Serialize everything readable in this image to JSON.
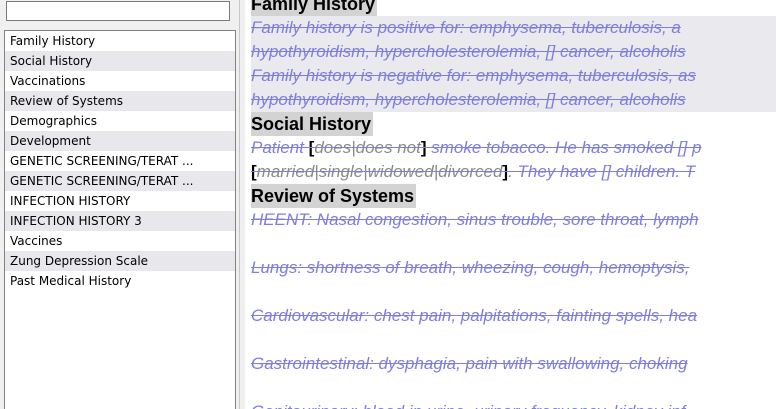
{
  "search": {
    "value": "",
    "placeholder": ""
  },
  "sidebar": {
    "items": [
      {
        "label": "Family History"
      },
      {
        "label": "Social History"
      },
      {
        "label": "Vaccinations"
      },
      {
        "label": "Review of Systems"
      },
      {
        "label": "Demographics"
      },
      {
        "label": "Development"
      },
      {
        "label": "GENETIC SCREENING/TERAT ..."
      },
      {
        "label": "GENETIC SCREENING/TERAT ..."
      },
      {
        "label": "INFECTION HISTORY"
      },
      {
        "label": "INFECTION HISTORY 3"
      },
      {
        "label": "Vaccines"
      },
      {
        "label": "Zung Depression Scale"
      },
      {
        "label": "Past Medical History"
      }
    ]
  },
  "document": {
    "family_history": {
      "heading": "Family History",
      "line1": "Family history is positive for: emphysema, tuberculosis, a",
      "line2": "hypothyroidism, hypercholesterolemia, [] cancer, alcoholis",
      "line3": "Family history is negative for: emphysema, tuberculosis, as",
      "line4": "hypothyroidism, hypercholesterolemia, [] cancer, alcoholis"
    },
    "social_history": {
      "heading": "Social History",
      "l1_prefix": "Patient ",
      "bracket_open": "[",
      "bracket_close": "]",
      "l1_opt_a": "does",
      "l1_sep": "|",
      "l1_opt_b": "does not",
      "l1_suffix": " smoke tobacco. He has smoked [] p",
      "l2_opt_a": "married",
      "l2_opt_b": "single",
      "l2_opt_c": "widowed",
      "l2_opt_d": "divorced",
      "l2_suffix": ". They have [] children. T"
    },
    "review_of_systems": {
      "heading": "Review of Systems",
      "heent": "HEENT: Nasal congestion, sinus trouble, sore throat, lymph",
      "lungs": "Lungs: shortness of breath, wheezing, cough, hemoptysis, ",
      "cardio": "Cardiovascular: chest pain, palpitations, fainting spells, hea",
      "gi": "Gastrointestinal: dysphagia, pain with swallowing, choking ",
      "gu": "Genitourinary: blood in urine, urinary frequency, kidney inf"
    }
  }
}
